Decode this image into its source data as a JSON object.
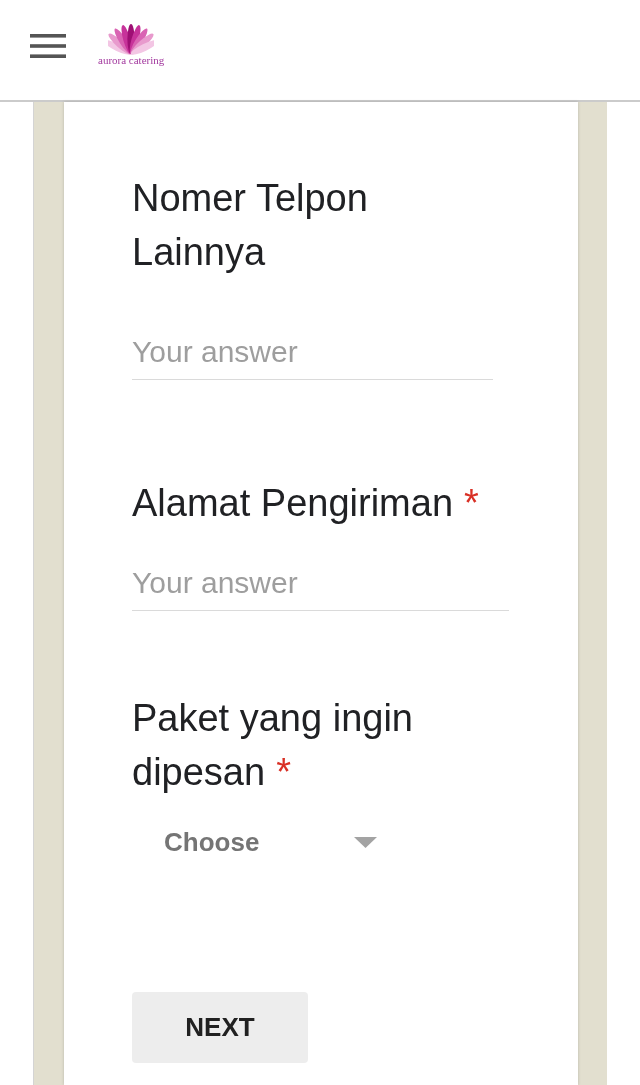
{
  "header": {
    "logo_text": "aurora catering"
  },
  "questions": [
    {
      "kind": "text",
      "title": "Nomer Telpon Lainnya",
      "placeholder": "Your answer"
    },
    {
      "kind": "text",
      "title": "Alamat Pengiriman",
      "required_mark": "*",
      "placeholder": "Your answer"
    },
    {
      "kind": "dropdown",
      "title": "Paket yang ingin dipesan",
      "required_mark": "*",
      "placeholder": "Choose"
    }
  ],
  "next_button": {
    "label": "NEXT"
  }
}
